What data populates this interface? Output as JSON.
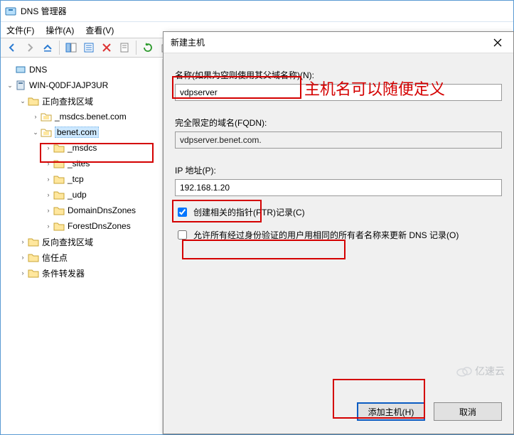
{
  "main": {
    "title": "DNS 管理器",
    "menu": {
      "file": "文件(F)",
      "action": "操作(A)",
      "view": "查看(V)"
    },
    "toolbar_icons": [
      "back",
      "forward",
      "up",
      "show-hide",
      "list",
      "properties",
      "refresh",
      "export",
      "help",
      "info",
      "help2"
    ],
    "tree": {
      "root": "DNS",
      "server": "WIN-Q0DFJAJP3UR",
      "fwd_zone": "正向查找区域",
      "z_msdcs": "_msdcs.benet.com",
      "z_benet": "benet.com",
      "sub_msdcs": "_msdcs",
      "sub_sites": "_sites",
      "sub_tcp": "_tcp",
      "sub_udp": "_udp",
      "sub_domaindns": "DomainDnsZones",
      "sub_forestdns": "ForestDnsZones",
      "rev_zone": "反向查找区域",
      "trust": "信任点",
      "forwarder": "条件转发器"
    }
  },
  "dialog": {
    "title": "新建主机",
    "name_label": "名称(如果为空则使用其父域名称)(N):",
    "name_value": "vdpserver",
    "fqdn_label": "完全限定的域名(FQDN):",
    "fqdn_value": "vdpserver.benet.com.",
    "ip_label": "IP 地址(P):",
    "ip_value": "192.168.1.20",
    "ptr_label": "创建相关的指针(PTR)记录(C)",
    "ptr_checked": true,
    "auth_label": "允许所有经过身份验证的用户用相同的所有者名称来更新 DNS 记录(O)",
    "auth_checked": false,
    "add_btn": "添加主机(H)",
    "cancel_btn": "取消"
  },
  "annotations": {
    "name_hint": "主机名可以随便定义"
  },
  "watermark": "亿速云"
}
